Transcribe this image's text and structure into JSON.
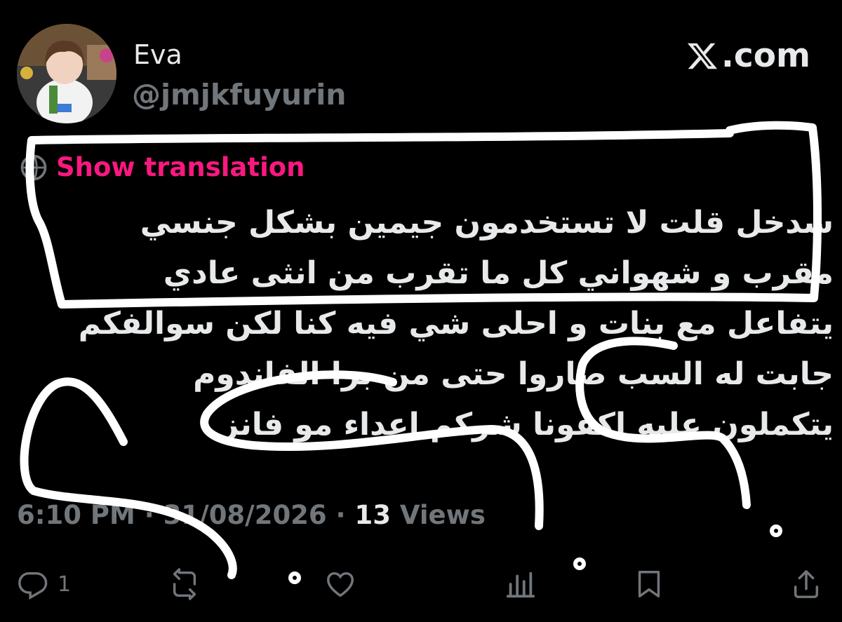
{
  "author": {
    "display_name": "Eva",
    "handle": "@jmjkfuyurin",
    "avatar_icon": "avatar-photo"
  },
  "brand": {
    "icon": "x-logo-icon",
    "text": ".com"
  },
  "tweet": {
    "translate_label": "Show translation",
    "lines": [
      "شدخل قلت لا تستخدمون جيمين بشكل جنسي",
      "مقرب و شهواني كل ما تقرب من انثى عادي",
      "يتفاعل مع بنات و احلى شي فيه كنا لكن سوالفكم",
      "جابت له السب صاروا حتى من برا الفاندوم",
      "يتكملون عليه اكفونا شركم اعداء مو فانز"
    ]
  },
  "meta": {
    "time": "6:10 PM",
    "separator": " · ",
    "date": "31/08/2026",
    "views_count": "13",
    "views_label": " Views"
  },
  "actions": {
    "reply_count": "1",
    "icons": [
      "reply-icon",
      "retweet-icon",
      "like-icon",
      "analytics-icon",
      "bookmark-icon",
      "share-icon"
    ]
  },
  "colors": {
    "background": "#000000",
    "text": "#e7e9ea",
    "muted": "#71767b",
    "accent": "#f91880",
    "scribble": "#ffffff"
  }
}
